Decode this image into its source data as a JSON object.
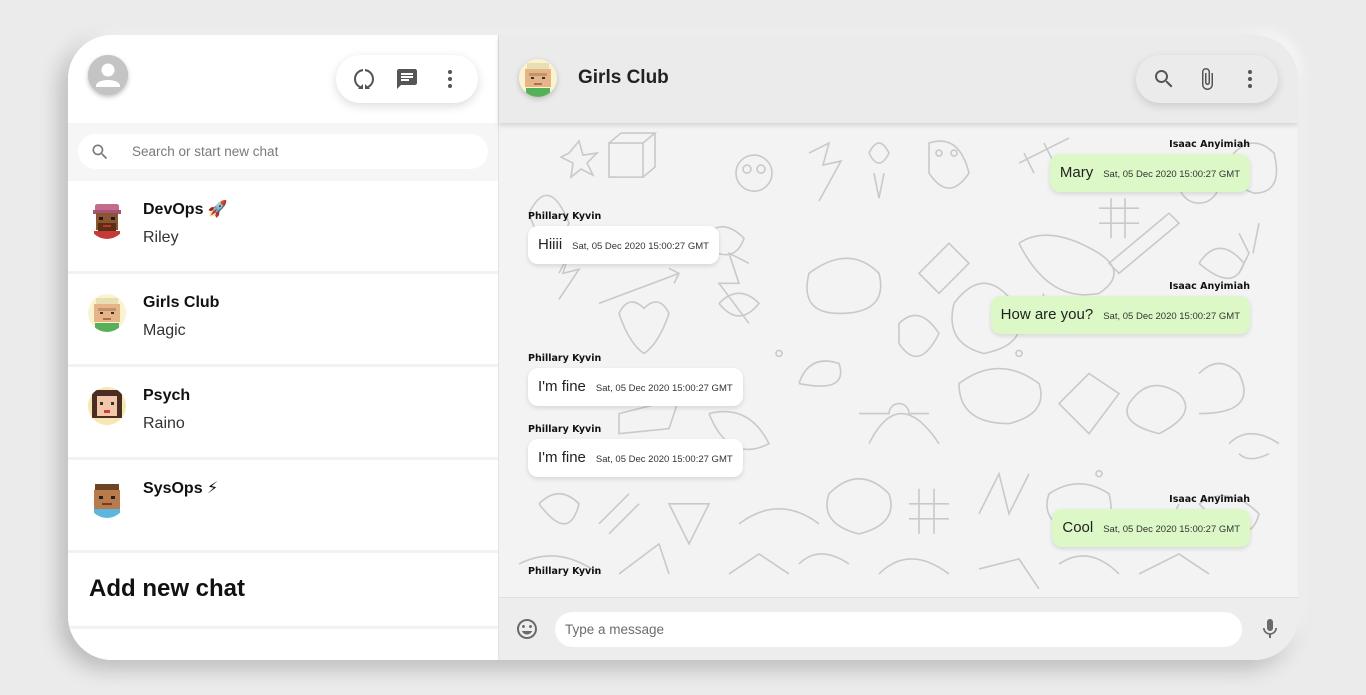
{
  "sidebar": {
    "search_placeholder": "Search or start new chat",
    "chats": [
      {
        "name": "DevOps 🚀",
        "last": "Riley"
      },
      {
        "name": "Girls Club",
        "last": "Magic"
      },
      {
        "name": "Psych",
        "last": "Raino"
      },
      {
        "name": "SysOps ⚡",
        "last": ""
      }
    ],
    "add_chat_label": "Add new chat"
  },
  "chat": {
    "title": "Girls Club",
    "messages": [
      {
        "sender": "Isaac Anyimiah",
        "text": "Mary",
        "time": "Sat, 05 Dec 2020 15:00:27 GMT",
        "direction": "out"
      },
      {
        "sender": "Phillary Kyvin",
        "text": "Hiiii",
        "time": "Sat, 05 Dec 2020 15:00:27 GMT",
        "direction": "in"
      },
      {
        "sender": "Isaac Anyimiah",
        "text": "How are you?",
        "time": "Sat, 05 Dec 2020 15:00:27 GMT",
        "direction": "out"
      },
      {
        "sender": "Phillary Kyvin",
        "text": "I'm fine",
        "time": "Sat, 05 Dec 2020 15:00:27 GMT",
        "direction": "in"
      },
      {
        "sender": "Phillary Kyvin",
        "text": "I'm fine",
        "time": "Sat, 05 Dec 2020 15:00:27 GMT",
        "direction": "in"
      },
      {
        "sender": "Isaac Anyimiah",
        "text": "Cool",
        "time": "Sat, 05 Dec 2020 15:00:27 GMT",
        "direction": "out"
      },
      {
        "sender": "Phillary Kyvin",
        "text": "",
        "time": "",
        "direction": "in"
      }
    ],
    "composer_placeholder": "Type a message"
  },
  "colors": {
    "outgoing_bubble": "#dcf8c6",
    "incoming_bubble": "#ffffff",
    "page_background": "#ebebeb"
  },
  "icons": {
    "sidebar_actions": [
      "status-icon",
      "new-chat-icon",
      "menu-icon"
    ],
    "header_actions": [
      "search-icon",
      "attach-icon",
      "menu-icon"
    ],
    "composer": [
      "emoji-icon",
      "mic-icon"
    ]
  }
}
